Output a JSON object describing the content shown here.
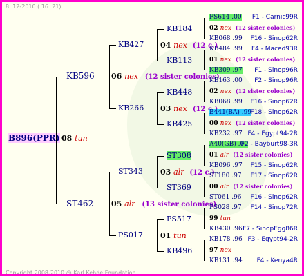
{
  "header": {
    "timestamp": "8. 12-2010 ( 16: 21)"
  },
  "footer": {
    "copyright": "Copyright 2008-2010 @ Karl Kehde Foundation"
  },
  "root": {
    "label": "B896(PPR)",
    "kid": "08",
    "kidtext": "tun"
  },
  "gen2": [
    {
      "label": "KB596",
      "kid": "06",
      "kidtext": "nex",
      "note": "(12 sister colonies)"
    },
    {
      "label": "ST462",
      "kid": "05",
      "kidtext": "alr",
      "note": "(13 sister colonies)"
    }
  ],
  "gen3": [
    {
      "label": "KB427",
      "kid": "04",
      "kidtext": "nex",
      "note": "(12 c.)"
    },
    {
      "label": "KB266",
      "kid": "03",
      "kidtext": "nex",
      "note": "(12 c.)"
    },
    {
      "label": "ST343",
      "kid": "03",
      "kidtext": "alr",
      "note": "(12 c.)"
    },
    {
      "label": "PS017",
      "kid": "01",
      "kidtext": "tun",
      "note": ""
    }
  ],
  "gen4": [
    {
      "label": "KB184"
    },
    {
      "label": "KB113"
    },
    {
      "label": "KB448"
    },
    {
      "label": "KB425"
    },
    {
      "label": "ST308"
    },
    {
      "label": "ST369"
    },
    {
      "label": "PS517"
    },
    {
      "label": "KB496"
    }
  ],
  "gen5": [
    {
      "text": "PS614 .00",
      "pos": "F1 - Carnic99R",
      "hl": "green"
    },
    {
      "num": "02",
      "numtxt": "nex",
      "note": "(12 sister colonies)"
    },
    {
      "text": "KB068 .99",
      "pos": "F16 - Sinop62R"
    },
    {
      "text": "KB484 .99",
      "pos": "F4 - Maced93R"
    },
    {
      "num": "01",
      "numtxt": "nex",
      "note": "(12 sister colonies)"
    },
    {
      "text": "KB309 .97",
      "pos": "F1 - Sinop96R",
      "hl": "green"
    },
    {
      "text": "KB163 .00",
      "pos": "F2 - Sinop96R"
    },
    {
      "num": "02",
      "numtxt": "nex",
      "note": "(12 sister colonies)"
    },
    {
      "text": "KB068 .99",
      "pos": "F16 - Sinop62R"
    },
    {
      "text": "B441(BA) .99",
      "pos": "F18 - Sinop62R",
      "hl": "cyan"
    },
    {
      "num": "00",
      "numtxt": "nex",
      "note": "(12 sister colonies)"
    },
    {
      "text": "KB232 .97",
      "pos": "F4 - Egypt94-2R"
    },
    {
      "text": "A40(GB) .00",
      "pos": "F2 - Bayburt98-3R",
      "hl": "green"
    },
    {
      "num": "01",
      "numtxt": "alr",
      "note": "(12 sister colonies)"
    },
    {
      "text": "KB096 .97",
      "pos": "F15 - Sinop62R"
    },
    {
      "text": "ST180 .97",
      "pos": "F17 - Sinop62R"
    },
    {
      "num": "00",
      "numtxt": "alr",
      "note": "(12 sister colonies)"
    },
    {
      "text": "ST061 .96",
      "pos": "F16 - Sinop62R"
    },
    {
      "text": "PS028 .97",
      "pos": "F14 - Sinop72R"
    },
    {
      "num": "99",
      "numtxt": "tun",
      "note": ""
    },
    {
      "text": "KB430 .96",
      "pos": "F7 - SinopEgg86R"
    },
    {
      "text": "KB178 .96",
      "pos": "F3 - Egypt94-2R"
    },
    {
      "num": "97",
      "numtxt": "nex",
      "note": ""
    },
    {
      "text": "KB131 .94",
      "pos": "F4 - Kenya4R"
    }
  ]
}
